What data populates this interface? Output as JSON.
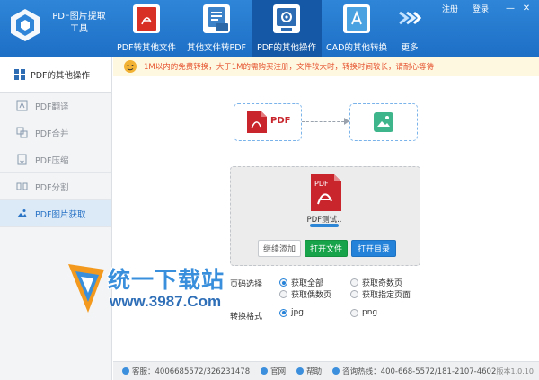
{
  "app": {
    "title_line1": "PDF图片提取",
    "title_line2": "工具"
  },
  "top_links": {
    "register": "注册",
    "login": "登录"
  },
  "toolbar": {
    "items": [
      {
        "label": "PDF转其他文件",
        "icon": "pdf-to-file-icon"
      },
      {
        "label": "其他文件转PDF",
        "icon": "file-to-pdf-icon"
      },
      {
        "label": "PDF的其他操作",
        "icon": "pdf-gear-icon"
      },
      {
        "label": "CAD的其他转换",
        "icon": "cad-convert-icon"
      }
    ],
    "more_label": "更多"
  },
  "sidebar": {
    "header": "PDF的其他操作",
    "items": [
      {
        "label": "PDF翻译"
      },
      {
        "label": "PDF合并"
      },
      {
        "label": "PDF压缩"
      },
      {
        "label": "PDF分割"
      },
      {
        "label": "PDF图片获取"
      }
    ],
    "active_index": 4
  },
  "notice": {
    "text": "1M以内的免费转换，大于1M的需购买注册，文件较大时，转换时间较长，请耐心等待"
  },
  "flow": {
    "source_label": "PDF"
  },
  "file": {
    "name": "PDF测试..",
    "progress": 1.0
  },
  "buttons": {
    "continue_add": "继续添加",
    "open_file": "打开文件",
    "open_folder": "打开目录"
  },
  "options": {
    "page_select_label": "页码选择",
    "page_options": [
      "获取全部",
      "获取奇数页",
      "获取偶数页",
      "获取指定页面"
    ],
    "page_selected": 0,
    "format_label": "转换格式",
    "format_options": [
      "jpg",
      "png"
    ],
    "format_selected": 0
  },
  "watermark": {
    "text": "统一下载站",
    "url": "www.3987.Com"
  },
  "footer": {
    "service": "客服：4006685572/326231478",
    "website": "官网",
    "help": "帮助",
    "hotline": "咨询热线：400-668-5572/181-2107-4602",
    "version": "版本1.0.10"
  },
  "colors": {
    "header_blue": "#2f86d8",
    "active_blue": "#1559a6",
    "accent_green": "#16a34a",
    "notice_red": "#e5532f"
  }
}
